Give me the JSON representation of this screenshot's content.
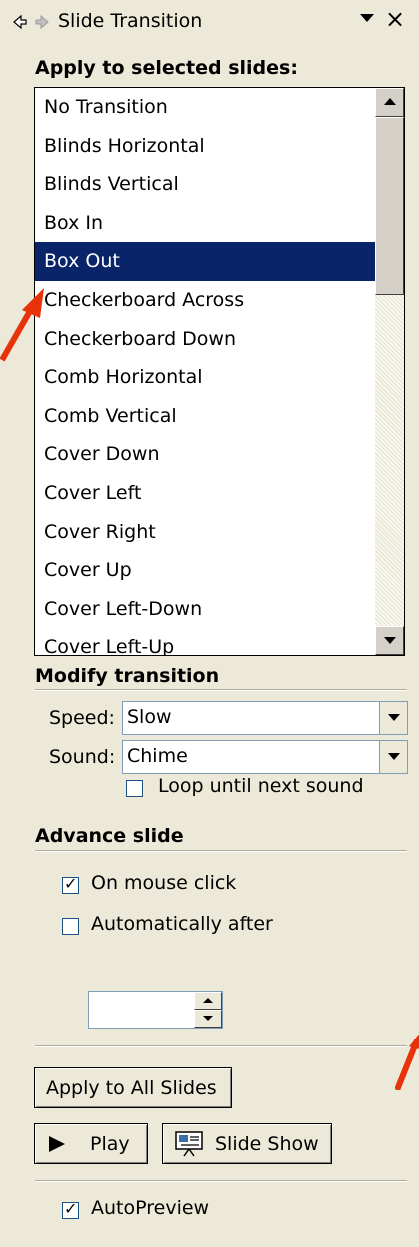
{
  "header": {
    "title": "Slide Transition",
    "close_glyph": "×"
  },
  "apply_section": {
    "heading": "Apply to selected slides:",
    "items": [
      "No Transition",
      "Blinds Horizontal",
      "Blinds Vertical",
      "Box In",
      "Box Out",
      "Checkerboard Across",
      "Checkerboard Down",
      "Comb Horizontal",
      "Comb Vertical",
      "Cover Down",
      "Cover Left",
      "Cover Right",
      "Cover Up",
      "Cover Left-Down",
      "Cover Left-Up"
    ],
    "selected": "Box Out"
  },
  "modify_section": {
    "heading": "Modify transition",
    "speed_label": "Speed:",
    "speed_value": "Slow",
    "sound_label": "Sound:",
    "sound_value": "Chime",
    "loop_label": "Loop until next sound",
    "loop_checked": false
  },
  "advance_section": {
    "heading": "Advance slide",
    "on_click_label": "On mouse click",
    "on_click_checked": true,
    "auto_label": "Automatically after",
    "auto_checked": false,
    "auto_value": ""
  },
  "buttons": {
    "apply_all": "Apply to All Slides",
    "play": "Play",
    "slide_show": "Slide Show"
  },
  "autopreview": {
    "label": "AutoPreview",
    "checked": true
  },
  "colors": {
    "panel_bg": "#ece9d8",
    "selection_bg": "#0a246a",
    "arrow": "#e8320a"
  }
}
